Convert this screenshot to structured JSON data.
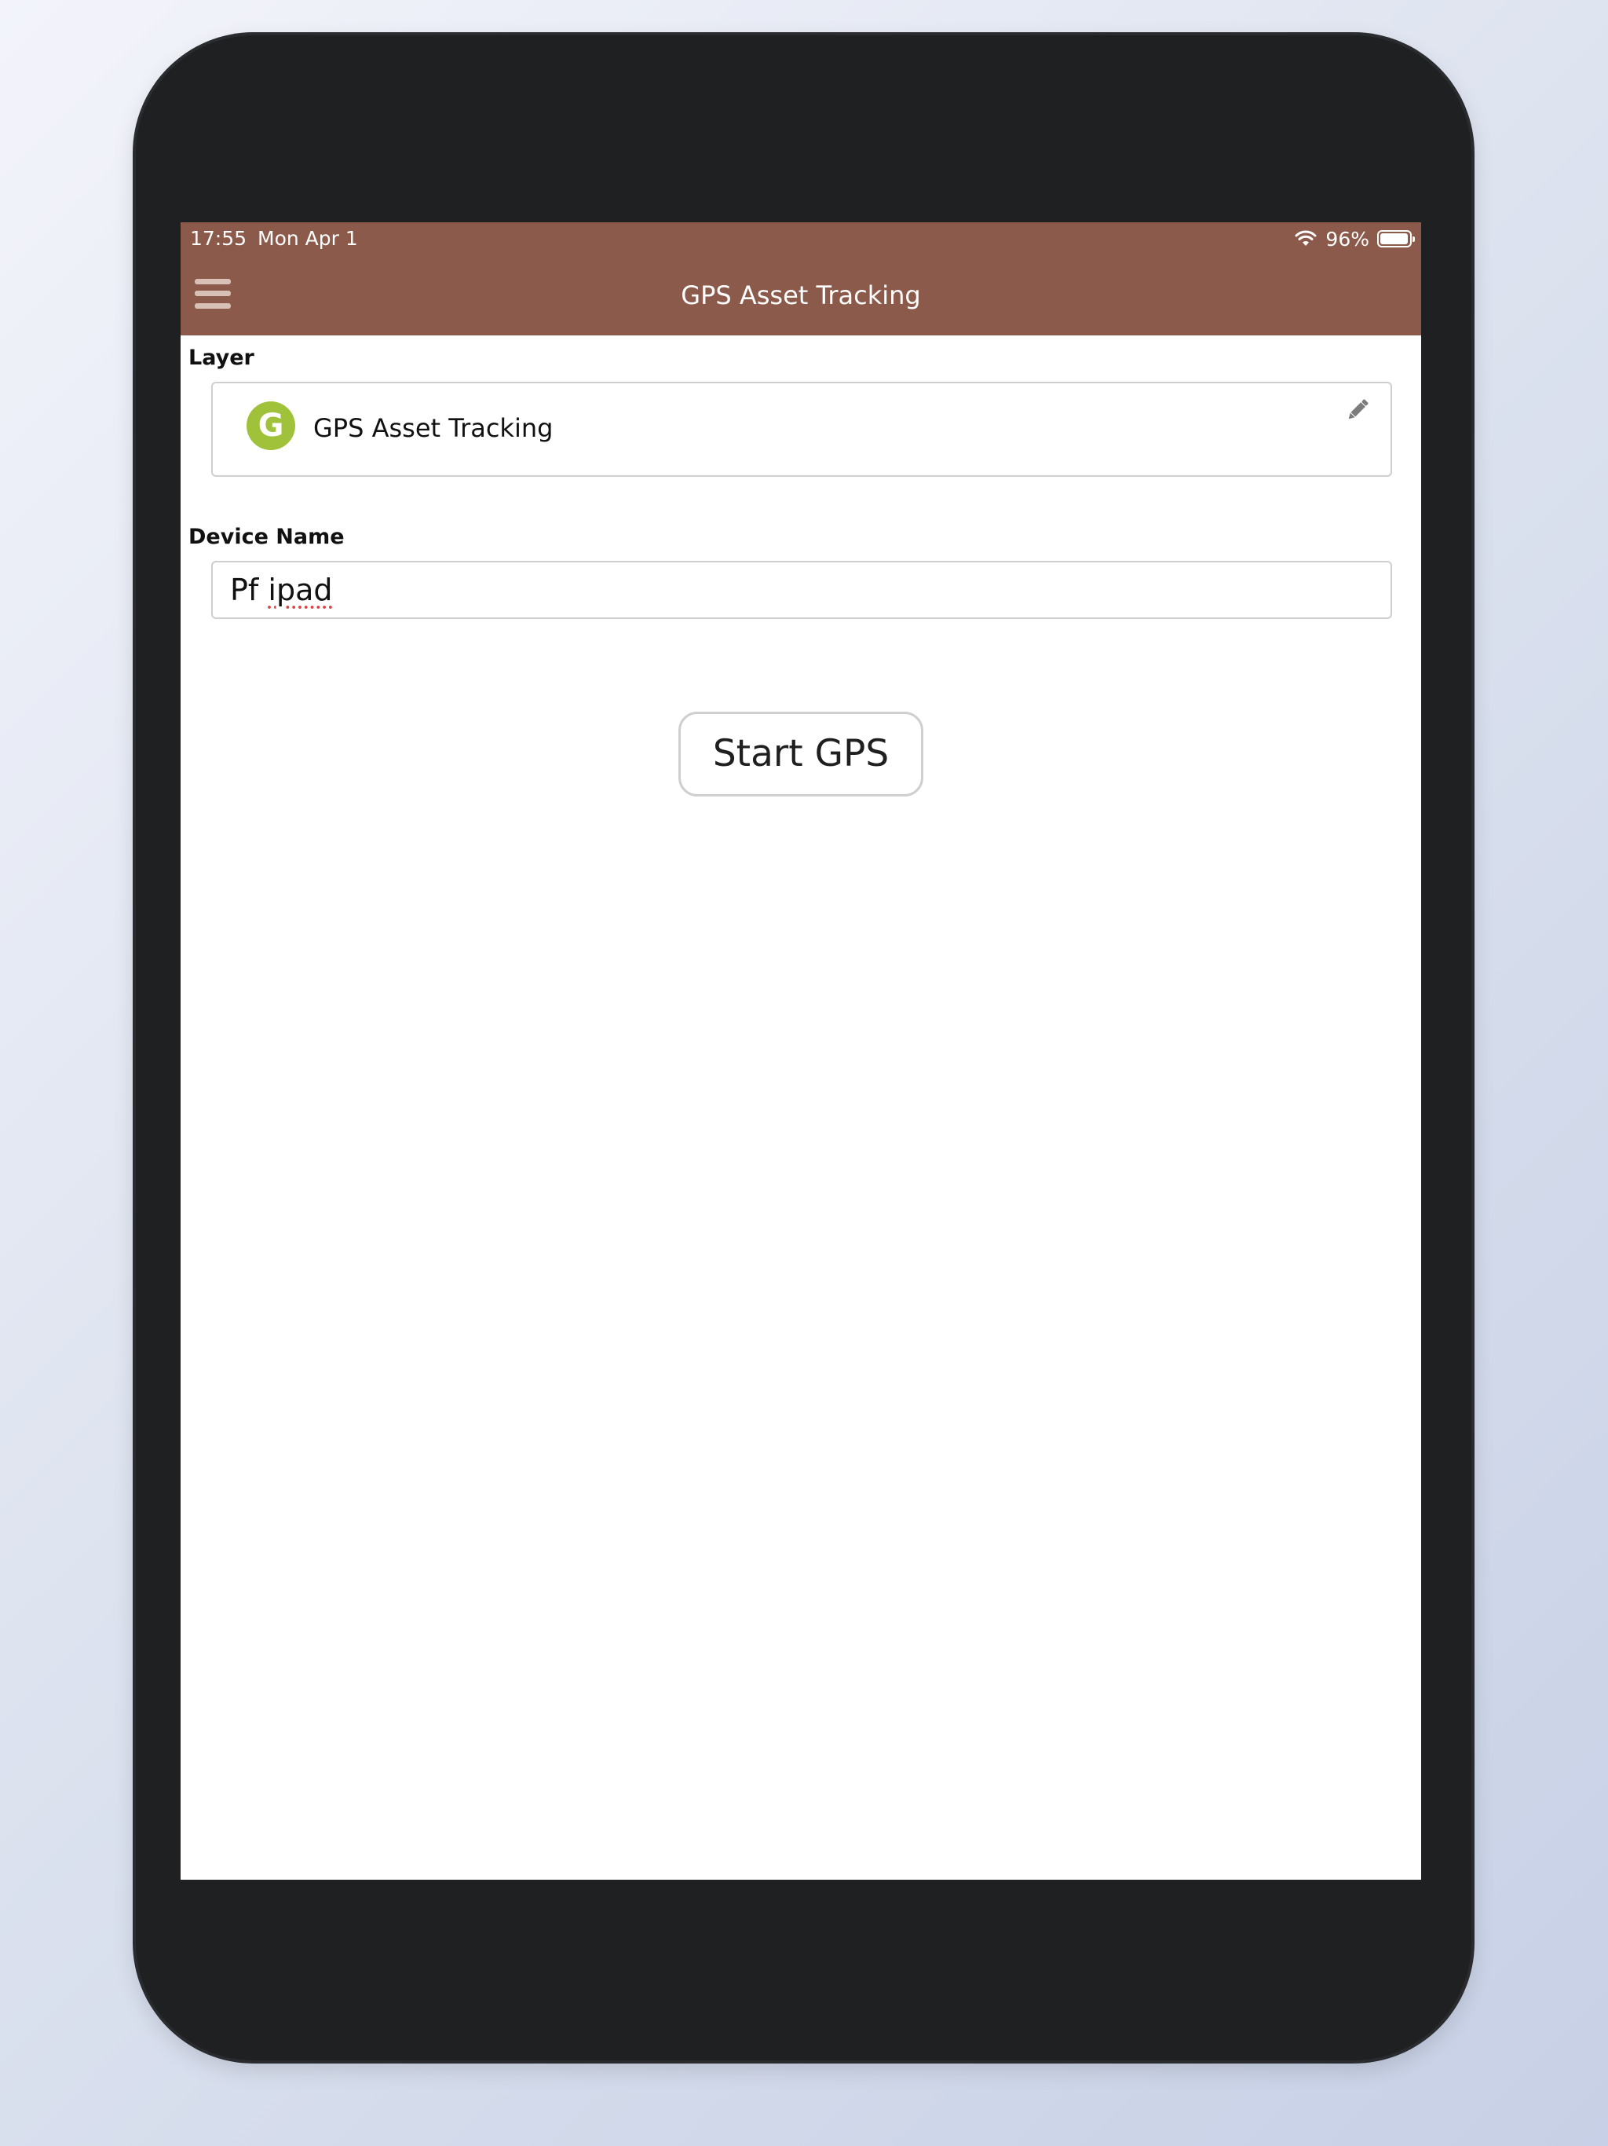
{
  "status_bar": {
    "time": "17:55",
    "date": "Mon Apr 1",
    "battery_percent": "96%",
    "battery_level": 0.96,
    "wifi_icon": "wifi-icon",
    "battery_icon": "battery-icon"
  },
  "app_bar": {
    "title": "GPS Asset Tracking",
    "menu_icon": "hamburger-menu-icon",
    "color": "#8b5a4a"
  },
  "layer": {
    "label": "Layer",
    "avatar_letter": "G",
    "avatar_color": "#9fc23a",
    "name": "GPS Asset Tracking",
    "edit_icon": "pencil-icon"
  },
  "device": {
    "label": "Device Name",
    "value_word1": "Pf",
    "value_word2": "ipad"
  },
  "actions": {
    "start_label": "Start GPS"
  }
}
